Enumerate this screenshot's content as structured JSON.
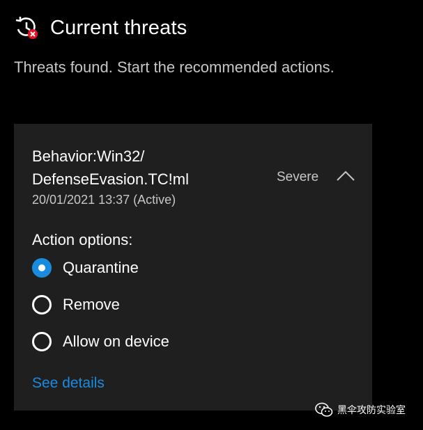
{
  "header": {
    "icon": "threat-history-icon",
    "title": "Current threats",
    "subtitle": "Threats found. Start the recommended actions."
  },
  "threat": {
    "name_line1": "Behavior:Win32/",
    "name_line2": "DefenseEvasion.TC!ml",
    "detected": "20/01/2021 13:37 (Active)",
    "severity": "Severe",
    "action_label": "Action options:",
    "options": [
      {
        "label": "Quarantine",
        "selected": true
      },
      {
        "label": "Remove",
        "selected": false
      },
      {
        "label": "Allow on device",
        "selected": false
      }
    ],
    "see_details": "See details"
  },
  "watermark": {
    "text": "黑伞攻防实验室",
    "icon": "wechat-icon"
  },
  "colors": {
    "background": "#000000",
    "card": "#1f1f1f",
    "accent": "#1a8ce0",
    "danger": "#e81123"
  }
}
